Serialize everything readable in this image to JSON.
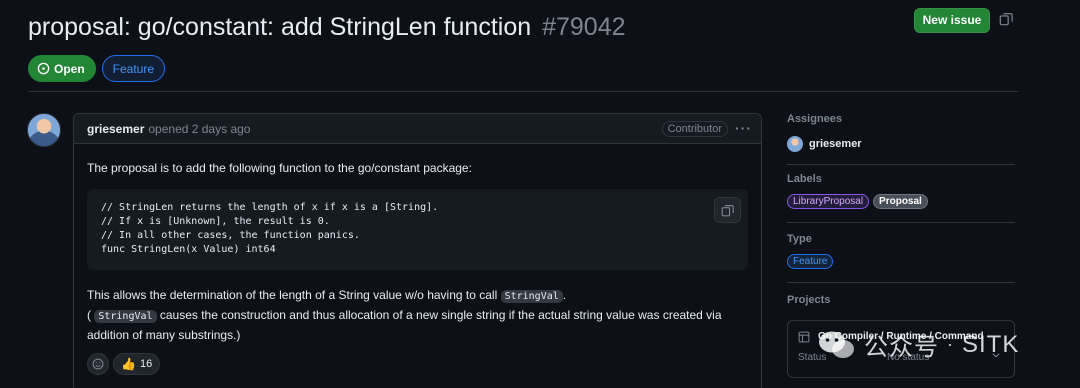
{
  "issue": {
    "title": "proposal: go/constant: add StringLen function",
    "number": "#79042",
    "state": "Open",
    "type": "Feature",
    "new_issue_label": "New issue"
  },
  "comment": {
    "author": "griesemer",
    "opened_text": "opened 2 days ago",
    "badge": "Contributor",
    "intro": "The proposal is to add the following function to the go/constant package:",
    "code_lines": [
      "// StringLen returns the length of x if x is a [String].",
      "// If x is [Unknown], the result is 0.",
      "// In all other cases, the function panics.",
      "func StringLen(x Value) int64"
    ],
    "para1_before": "This allows the determination of the length of a String value w/o having to call ",
    "para1_code": "StringVal",
    "para1_after": ".",
    "para2_open": "( ",
    "para2_code": "StringVal",
    "para2_after": " causes the construction and thus allocation of a new single string if the actual string value was created via addition of many substrings.)",
    "reaction_emoji": "👍",
    "reaction_count": "16"
  },
  "sidebar": {
    "assignees_heading": "Assignees",
    "assignee": "griesemer",
    "labels_heading": "Labels",
    "labels": [
      "LibraryProposal",
      "Proposal"
    ],
    "type_heading": "Type",
    "type_value": "Feature",
    "projects_heading": "Projects",
    "project_title": "Go Compiler / Runtime / Command",
    "status_key": "Status",
    "status_value": "No status"
  },
  "watermark": {
    "left": "公众号",
    "sep": "·",
    "right": "SITK"
  },
  "colors": {
    "background": "#0d1117",
    "open_green": "#238636",
    "accent_blue": "#4493f8",
    "border": "#30363d"
  }
}
